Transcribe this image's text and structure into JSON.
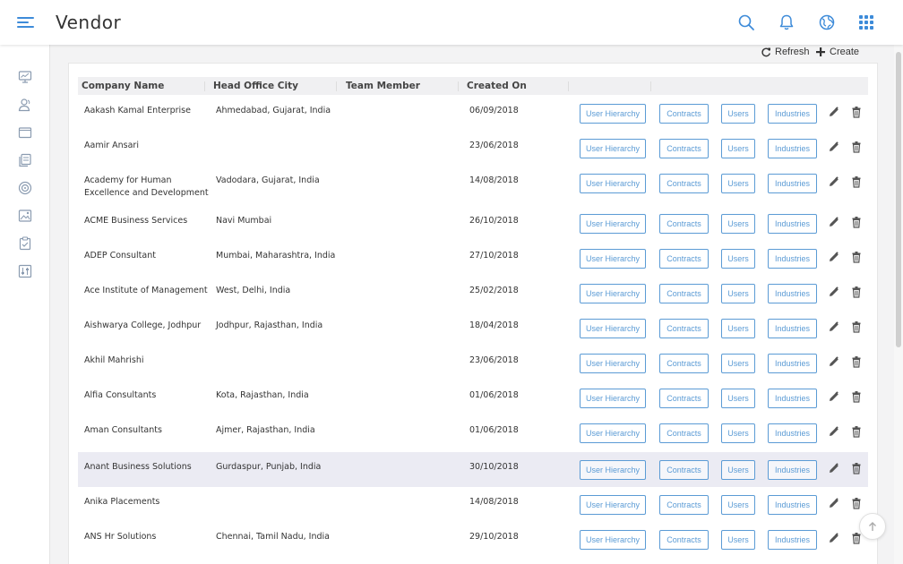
{
  "header": {
    "title": "Vendor",
    "icons": [
      "menu-icon",
      "search-icon",
      "bell-icon",
      "globe-icon",
      "apps-grid-icon"
    ]
  },
  "sidebar": {
    "icons": [
      "dashboard-icon",
      "users-icon",
      "folder-icon",
      "documents-icon",
      "target-icon",
      "image-icon",
      "clipboard-icon",
      "sliders-icon"
    ]
  },
  "toolbar": {
    "refresh_label": "Refresh",
    "create_label": "Create"
  },
  "table": {
    "columns": [
      "Company Name",
      "Head Office City",
      "Team Member",
      "Created On"
    ],
    "action_labels": {
      "user_hierarchy": "User Hierarchy",
      "contracts": "Contracts",
      "users": "Users",
      "industries": "Industries"
    },
    "rows": [
      {
        "company": "Aakash Kamal Enterprise",
        "city": "Ahmedabad, Gujarat, India",
        "team": "",
        "created": "06/09/2018"
      },
      {
        "company": "Aamir Ansari",
        "city": "",
        "team": "",
        "created": "23/06/2018"
      },
      {
        "company": "Academy for Human Excellence and Development",
        "city": "Vadodara, Gujarat, India",
        "team": "",
        "created": "14/08/2018"
      },
      {
        "company": "ACME Business Services",
        "city": "Navi Mumbai",
        "team": "",
        "created": "26/10/2018"
      },
      {
        "company": "ADEP Consultant",
        "city": "Mumbai, Maharashtra, India",
        "team": "",
        "created": "27/10/2018"
      },
      {
        "company": "Ace Institute of Management",
        "city": "West, Delhi, India",
        "team": "",
        "created": "25/02/2018"
      },
      {
        "company": "Aishwarya College, Jodhpur",
        "city": "Jodhpur, Rajasthan, India",
        "team": "",
        "created": "18/04/2018"
      },
      {
        "company": "Akhil Mahrishi",
        "city": "",
        "team": "",
        "created": "23/06/2018"
      },
      {
        "company": "Alfia Consultants",
        "city": "Kota, Rajasthan, India",
        "team": "",
        "created": "01/06/2018"
      },
      {
        "company": "Aman Consultants",
        "city": "Ajmer, Rajasthan, India",
        "team": "",
        "created": "01/06/2018"
      },
      {
        "company": "Anant Business Solutions",
        "city": "Gurdaspur, Punjab, India",
        "team": "",
        "created": "30/10/2018"
      },
      {
        "company": "Anika Placements",
        "city": "",
        "team": "",
        "created": "14/08/2018"
      },
      {
        "company": "ANS Hr Solutions",
        "city": "Chennai, Tamil Nadu, India",
        "team": "",
        "created": "29/10/2018"
      }
    ]
  },
  "colors": {
    "accent": "#3d8bd9",
    "action_border": "#5b9bd5",
    "highlight_row": "#ebebf3"
  }
}
